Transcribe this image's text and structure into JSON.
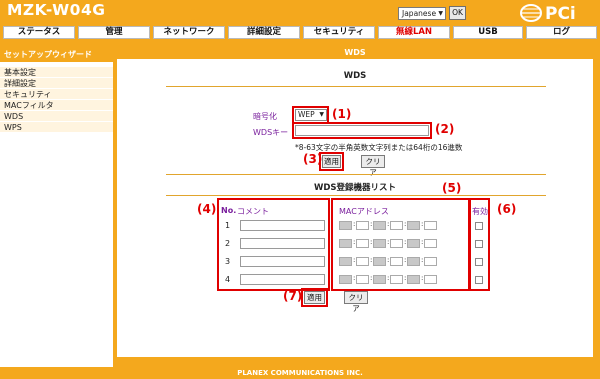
{
  "header": {
    "model": "MZK-W04G",
    "language_selected": "Japanese",
    "ok_label": "OK",
    "logo_text": "PCi"
  },
  "nav": {
    "items": [
      {
        "label": "ステータス",
        "highlight": false
      },
      {
        "label": "管理",
        "highlight": false
      },
      {
        "label": "ネットワーク",
        "highlight": false
      },
      {
        "label": "詳細設定",
        "highlight": false
      },
      {
        "label": "セキュリティ",
        "highlight": false
      },
      {
        "label": "無線LAN",
        "highlight": true
      },
      {
        "label": "USB",
        "highlight": false
      },
      {
        "label": "ログ",
        "highlight": false
      }
    ]
  },
  "sidebar": {
    "header": "セットアップウィザード",
    "items": [
      {
        "label": "基本設定"
      },
      {
        "label": "詳細設定"
      },
      {
        "label": "セキュリティ"
      },
      {
        "label": "MACフィルタ"
      },
      {
        "label": "WDS"
      },
      {
        "label": "WPS"
      }
    ]
  },
  "main": {
    "title_bar": "WDS",
    "section_title": "WDS",
    "encryption_label": "暗号化",
    "encryption_value": "WEP",
    "wds_key_label": "WDSキー",
    "hint": "*8-63文字の半角英数文字列または64桁の16進数",
    "apply_label": "適用",
    "clear_label": "クリア",
    "list_title": "WDS登録機器リスト",
    "col_no": "No.",
    "col_comment": "コメント",
    "col_mac": "MACアドレス",
    "col_enable": "有効",
    "rows": [
      "1",
      "2",
      "3",
      "4"
    ],
    "list_apply_label": "適用",
    "list_clear_label": "クリア"
  },
  "annotations": [
    "(1)",
    "(2)",
    "(3)",
    "(4)",
    "(5)",
    "(6)",
    "(7)"
  ],
  "footer": "PLANEX COMMUNICATIONS INC.",
  "colors": {
    "brand_orange": "#f4a81d",
    "accent_purple": "#7a1f9d",
    "annotation_red": "#e00000"
  }
}
